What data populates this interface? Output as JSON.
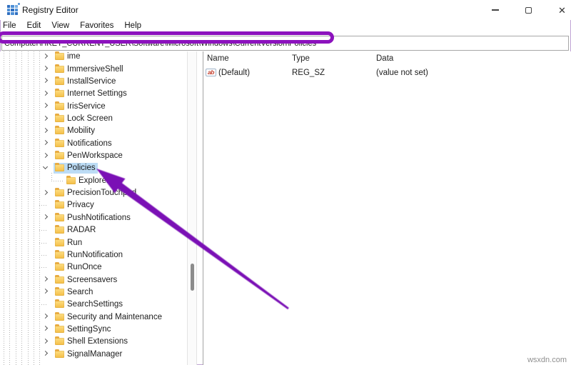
{
  "window": {
    "title": "Registry Editor",
    "controls": [
      "minimize",
      "maximize",
      "close"
    ]
  },
  "menu": {
    "items": [
      "File",
      "Edit",
      "View",
      "Favorites",
      "Help"
    ]
  },
  "address_bar": {
    "value": "Computer\\HKEY_CURRENT_USER\\Software\\Microsoft\\Windows\\CurrentVersion\\Policies"
  },
  "tree": {
    "items": [
      {
        "label": "ime",
        "chevron": "collapsed",
        "level": 0,
        "selected": false
      },
      {
        "label": "ImmersiveShell",
        "chevron": "collapsed",
        "level": 0,
        "selected": false
      },
      {
        "label": "InstallService",
        "chevron": "collapsed",
        "level": 0,
        "selected": false
      },
      {
        "label": "Internet Settings",
        "chevron": "collapsed",
        "level": 0,
        "selected": false
      },
      {
        "label": "IrisService",
        "chevron": "collapsed",
        "level": 0,
        "selected": false
      },
      {
        "label": "Lock Screen",
        "chevron": "collapsed",
        "level": 0,
        "selected": false
      },
      {
        "label": "Mobility",
        "chevron": "collapsed",
        "level": 0,
        "selected": false
      },
      {
        "label": "Notifications",
        "chevron": "collapsed",
        "level": 0,
        "selected": false
      },
      {
        "label": "PenWorkspace",
        "chevron": "collapsed",
        "level": 0,
        "selected": false
      },
      {
        "label": "Policies",
        "chevron": "expanded",
        "level": 0,
        "selected": true
      },
      {
        "label": "Explorer",
        "chevron": "none",
        "level": 1,
        "selected": false
      },
      {
        "label": "PrecisionTouchpad",
        "chevron": "collapsed",
        "level": 0,
        "selected": false
      },
      {
        "label": "Privacy",
        "chevron": "none",
        "level": 0,
        "selected": false
      },
      {
        "label": "PushNotifications",
        "chevron": "collapsed",
        "level": 0,
        "selected": false
      },
      {
        "label": "RADAR",
        "chevron": "none",
        "level": 0,
        "selected": false
      },
      {
        "label": "Run",
        "chevron": "none",
        "level": 0,
        "selected": false
      },
      {
        "label": "RunNotification",
        "chevron": "none",
        "level": 0,
        "selected": false
      },
      {
        "label": "RunOnce",
        "chevron": "none",
        "level": 0,
        "selected": false
      },
      {
        "label": "Screensavers",
        "chevron": "collapsed",
        "level": 0,
        "selected": false
      },
      {
        "label": "Search",
        "chevron": "collapsed",
        "level": 0,
        "selected": false
      },
      {
        "label": "SearchSettings",
        "chevron": "none",
        "level": 0,
        "selected": false
      },
      {
        "label": "Security and Maintenance",
        "chevron": "collapsed",
        "level": 0,
        "selected": false
      },
      {
        "label": "SettingSync",
        "chevron": "collapsed",
        "level": 0,
        "selected": false
      },
      {
        "label": "Shell Extensions",
        "chevron": "collapsed",
        "level": 0,
        "selected": false
      },
      {
        "label": "SignalManager",
        "chevron": "collapsed",
        "level": 0,
        "selected": false
      }
    ]
  },
  "list": {
    "columns": [
      "Name",
      "Type",
      "Data"
    ],
    "rows": [
      {
        "icon": "string-value-icon",
        "icon_glyph": "ab",
        "name": "(Default)",
        "type": "REG_SZ",
        "data": "(value not set)"
      }
    ]
  },
  "annotations": {
    "highlight_color": "#8c12bd",
    "arrow_color": "#7a10b5"
  },
  "watermark": "wsxdn.com"
}
